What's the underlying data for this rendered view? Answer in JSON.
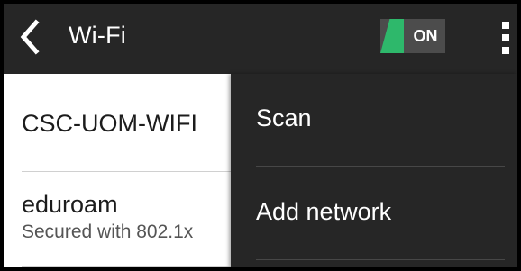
{
  "action_bar": {
    "title": "Wi-Fi",
    "back_icon": "chevron-left-icon",
    "toggle": {
      "label": "ON",
      "state": "on",
      "accent_color": "#2eb86b"
    },
    "overflow_icon": "more-vertical-icon"
  },
  "networks": [
    {
      "name": "CSC-UOM-WIFI",
      "subtitle": ""
    },
    {
      "name": "eduroam",
      "subtitle": "Secured with 802.1x"
    }
  ],
  "menu": {
    "items": [
      {
        "label": "Scan"
      },
      {
        "label": "Add network"
      }
    ]
  },
  "colors": {
    "action_bar_bg": "#262626",
    "menu_bg": "#262626",
    "list_bg": "#ffffff",
    "toggle_on": "#2eb86b"
  }
}
